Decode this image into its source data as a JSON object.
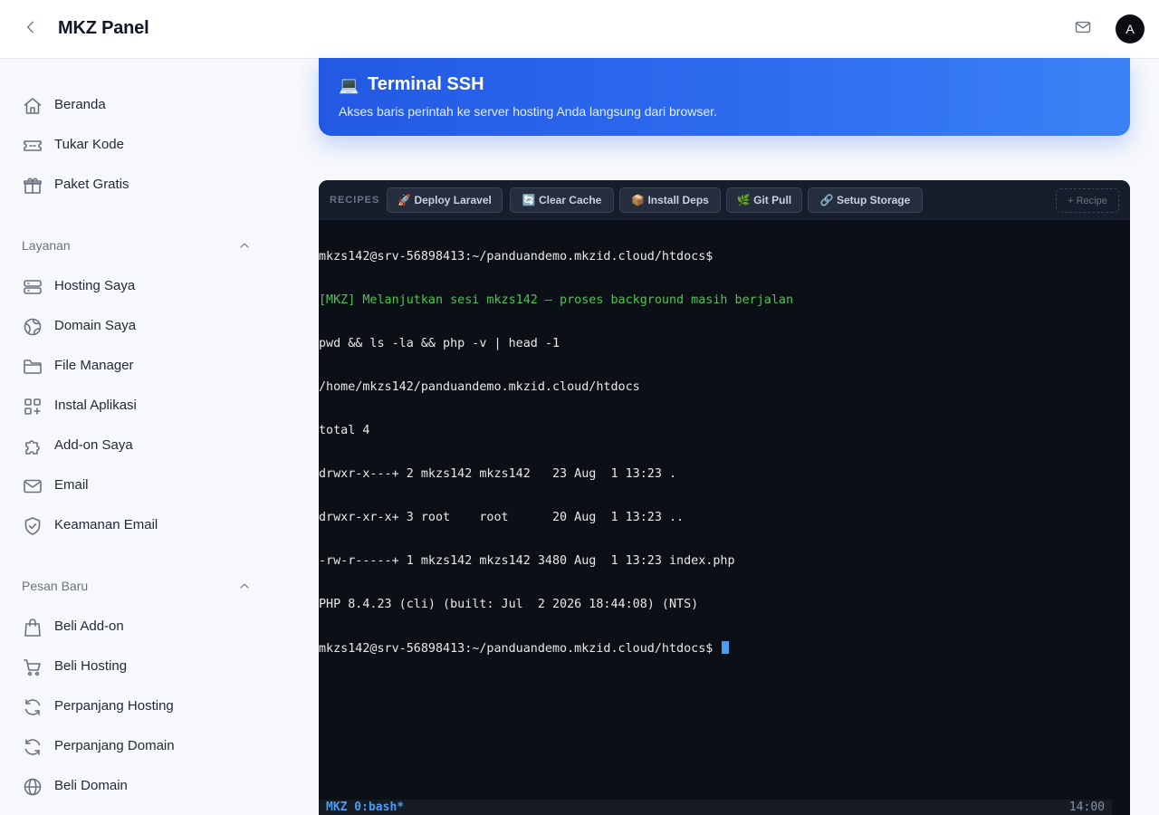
{
  "header": {
    "title": "MKZ Panel",
    "avatar_initial": "A",
    "icons": [
      "chevron-left-icon",
      "mail-icon"
    ]
  },
  "sidebar": {
    "items": [
      {
        "label": "Beranda",
        "icon": "home-icon"
      },
      {
        "label": "Tukar Kode",
        "icon": "ticket-icon"
      },
      {
        "label": "Paket Gratis",
        "icon": "gift-icon"
      }
    ],
    "sections": [
      {
        "title": "Layanan",
        "items": [
          {
            "label": "Hosting Saya",
            "icon": "server-icon"
          },
          {
            "label": "Domain Saya",
            "icon": "globe-icon"
          },
          {
            "label": "File Manager",
            "icon": "folder-icon"
          },
          {
            "label": "Instal Aplikasi",
            "icon": "apps-icon"
          },
          {
            "label": "Add-on Saya",
            "icon": "puzzle-icon"
          },
          {
            "label": "Email",
            "icon": "mail-icon"
          },
          {
            "label": "Keamanan Email",
            "icon": "shield-check-icon"
          }
        ]
      },
      {
        "title": "Pesan Baru",
        "items": [
          {
            "label": "Beli Add-on",
            "icon": "shopping-bag-icon"
          },
          {
            "label": "Beli Hosting",
            "icon": "cart-icon"
          },
          {
            "label": "Perpanjang Hosting",
            "icon": "refresh-icon"
          },
          {
            "label": "Perpanjang Domain",
            "icon": "refresh-icon"
          },
          {
            "label": "Beli Domain",
            "icon": "globe-icon"
          }
        ]
      }
    ]
  },
  "hero": {
    "icon": "💻",
    "title": "Terminal SSH",
    "subtitle": "Akses baris perintah ke server hosting Anda langsung dari browser."
  },
  "terminal": {
    "recipes_label": "RECIPES",
    "recipes": [
      {
        "icon": "🚀",
        "label": "Deploy Laravel"
      },
      {
        "icon": "🔄",
        "label": "Clear Cache"
      },
      {
        "icon": "📦",
        "label": "Install Deps"
      },
      {
        "icon": "🌿",
        "label": "Git Pull"
      },
      {
        "icon": "🔗",
        "label": "Setup Storage"
      }
    ],
    "add_recipe_label": "+ Recipe",
    "lines": [
      "mkzs142@srv-56898413:~/panduandemo.mkzid.cloud/htdocs$",
      "[MKZ] Melanjutkan sesi mkzs142 — proses background masih berjalan",
      "pwd && ls -la && php -v | head -1",
      "/home/mkzs142/panduandemo.mkzid.cloud/htdocs",
      "total 4",
      "drwxr-x---+ 2 mkzs142 mkzs142   23 Aug  1 13:23 .",
      "drwxr-xr-x+ 3 root    root      20 Aug  1 13:23 ..",
      "-rw-r-----+ 1 mkzs142 mkzs142 3480 Aug  1 13:23 index.php",
      "PHP 8.4.23 (cli) (built: Jul  2 2026 18:44:08) (NTS)",
      "mkzs142@srv-56898413:~/panduandemo.mkzid.cloud/htdocs$ "
    ],
    "status_left": "MKZ 0:bash*",
    "status_right": "14:00",
    "colors": {
      "background": "#0b0f16",
      "accent_green": "#4ec44e",
      "cursor_blue": "#4a9cf5"
    }
  }
}
